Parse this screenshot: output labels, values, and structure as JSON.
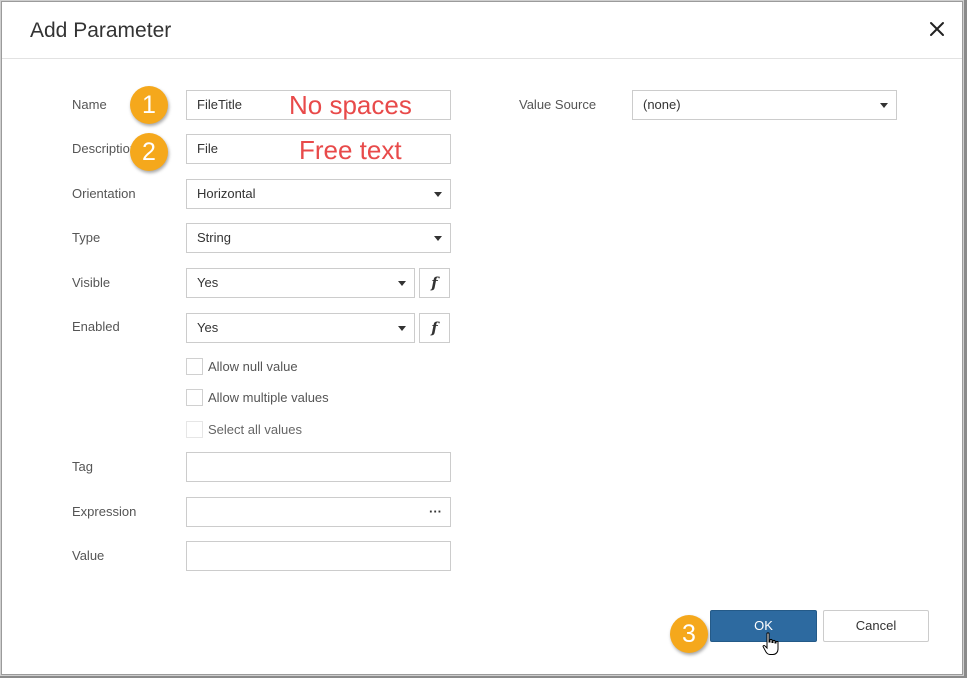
{
  "dialog": {
    "title": "Add Parameter",
    "close_icon": "close-icon"
  },
  "form": {
    "name": {
      "label": "Name",
      "value": "FileTitle"
    },
    "description": {
      "label": "Description",
      "value": "File"
    },
    "orientation": {
      "label": "Orientation",
      "value": "Horizontal"
    },
    "type": {
      "label": "Type",
      "value": "String"
    },
    "visible": {
      "label": "Visible",
      "value": "Yes",
      "fx_label": "f"
    },
    "enabled": {
      "label": "Enabled",
      "value": "Yes",
      "fx_label": "f"
    },
    "checkboxes": [
      {
        "label": "Allow null value",
        "checked": false,
        "disabled": false
      },
      {
        "label": "Allow multiple values",
        "checked": false,
        "disabled": false
      },
      {
        "label": "Select all values",
        "checked": false,
        "disabled": true
      }
    ],
    "tag": {
      "label": "Tag",
      "value": ""
    },
    "expression": {
      "label": "Expression",
      "value": "",
      "ellipsis": "···"
    },
    "value": {
      "label": "Value",
      "value": ""
    },
    "value_source": {
      "label": "Value Source",
      "value": "(none)"
    }
  },
  "annotations": {
    "badge1": "1",
    "badge2": "2",
    "badge3": "3",
    "note1": "No spaces",
    "note2": "Free text"
  },
  "buttons": {
    "ok": "OK",
    "cancel": "Cancel"
  },
  "colors": {
    "accent": "#2d6aa0",
    "badge": "#f5a81c",
    "annotation": "#e84a4a"
  }
}
